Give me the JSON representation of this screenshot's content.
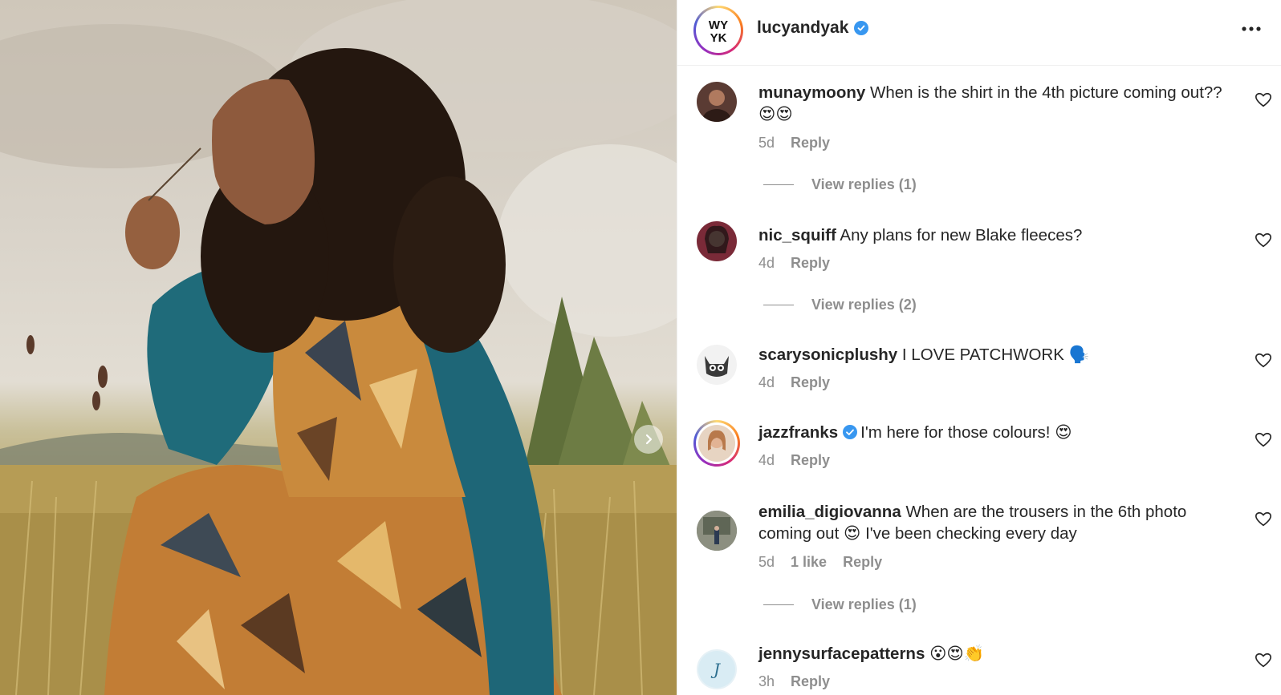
{
  "post": {
    "account": "lucyandyak",
    "verified": true,
    "logo_text": [
      "WY",
      "YK"
    ],
    "more_icon": "more-horizontal-icon"
  },
  "comments": [
    {
      "user": "munaymoony",
      "text": "When is the shirt in the 4th picture coming out??",
      "emoji": "😍😍",
      "time": "5d",
      "likes": "",
      "reply_label": "Reply",
      "view_replies": "View replies (1)",
      "avatar_color": "#5a3b33"
    },
    {
      "user": "nic_squiff",
      "text": "Any plans for new Blake fleeces?",
      "emoji": "",
      "time": "4d",
      "likes": "",
      "reply_label": "Reply",
      "view_replies": "View replies (2)",
      "avatar_color": "#7a2a38"
    },
    {
      "user": "scarysonicplushy",
      "text": "I LOVE PATCHWORK",
      "emoji": "🗣️",
      "time": "4d",
      "likes": "",
      "reply_label": "Reply",
      "view_replies": "",
      "avatar_color": "#3a3a3a"
    },
    {
      "user": "jazzfranks",
      "verified": true,
      "text": "I'm here for those colours!",
      "emoji": "😍",
      "time": "4d",
      "likes": "",
      "reply_label": "Reply",
      "view_replies": "",
      "avatar_color": "#c9926a"
    },
    {
      "user": "emilia_digiovanna",
      "text_before": "When are the trousers in the 6th photo coming out",
      "emoji": "😍",
      "text_after": "I've been checking every day",
      "time": "5d",
      "likes": "1 like",
      "reply_label": "Reply",
      "view_replies": "View replies (1)",
      "avatar_color": "#6b6f62"
    },
    {
      "user": "jennysurfacepatterns",
      "text": "",
      "emoji": "😮😍👏",
      "time": "3h",
      "likes": "",
      "reply_label": "Reply",
      "view_replies": "",
      "avatar_color": "#cde4ef"
    }
  ],
  "colors": {
    "text": "#262626",
    "secondary": "#8e8e8e",
    "verified": "#3897f0",
    "divider": "#efefef"
  }
}
